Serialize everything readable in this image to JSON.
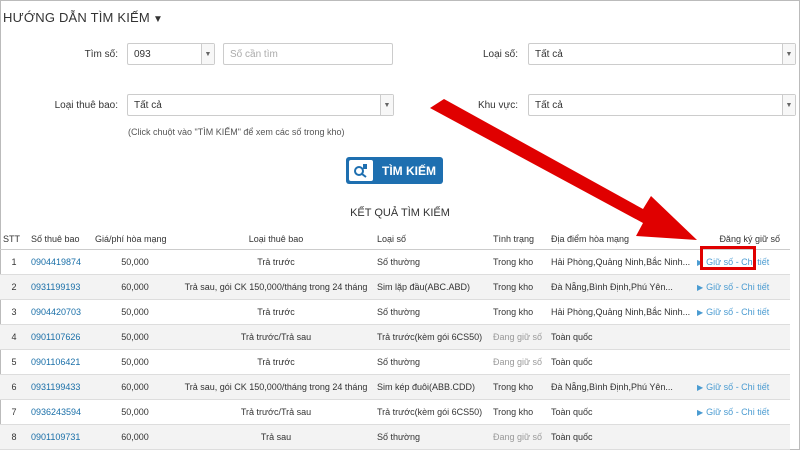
{
  "guide_title": "HƯỚNG DẪN TÌM KIẾM",
  "form": {
    "tim_so_label": "Tìm số:",
    "prefix_value": "093",
    "number_placeholder": "Số cần tìm",
    "loai_so_label": "Loại số:",
    "loai_so_value": "Tất cả",
    "loai_thue_bao_label": "Loại thuê bao:",
    "loai_thue_bao_value": "Tất cả",
    "khu_vuc_label": "Khu vực:",
    "khu_vuc_value": "Tất cả",
    "hint": "(Click chuột vào \"TÌM KIẾM\" để xem các số trong kho)",
    "search_button": "TÌM KIẾM"
  },
  "results": {
    "title": "KẾT QUẢ TÌM KIẾM",
    "headers": [
      "STT",
      "Số thuê bao",
      "Giá/phí hòa mạng",
      "Loại thuê bao",
      "Loại số",
      "Tình trạng",
      "Địa điểm hòa mạng",
      "Đăng ký giữ số"
    ],
    "rows": [
      [
        "1",
        "0904419874",
        "50,000",
        "Trả trước",
        "Số thường",
        "Trong kho",
        "Hải Phòng,Quảng Ninh,Bắc Ninh...",
        "Giữ số - Chi tiết"
      ],
      [
        "2",
        "0931199193",
        "60,000",
        "Trả sau, gói CK 150,000/tháng trong 24 tháng",
        "Sim lặp đầu(ABC.ABD)",
        "Trong kho",
        "Đà Nẵng,Bình Định,Phú Yên...",
        "Giữ số - Chi tiết"
      ],
      [
        "3",
        "0904420703",
        "50,000",
        "Trả trước",
        "Số thường",
        "Trong kho",
        "Hải Phòng,Quảng Ninh,Bắc Ninh...",
        "Giữ số - Chi tiết"
      ],
      [
        "4",
        "0901107626",
        "50,000",
        "Trả trước/Trả sau",
        "Trả trước(kèm gói 6CS50)",
        "Đang giữ số",
        "Toàn quốc",
        ""
      ],
      [
        "5",
        "0901106421",
        "50,000",
        "Trả trước",
        "Số thường",
        "Đang giữ số",
        "Toàn quốc",
        ""
      ],
      [
        "6",
        "0931199433",
        "60,000",
        "Trả sau, gói CK 150,000/tháng trong 24 tháng",
        "Sim kép đuôi(ABB.CDD)",
        "Trong kho",
        "Đà Nẵng,Bình Định,Phú Yên...",
        "Giữ số - Chi tiết"
      ],
      [
        "7",
        "0936243594",
        "50,000",
        "Trả trước/Trả sau",
        "Trả trước(kèm gói 6CS50)",
        "Trong kho",
        "Toàn quốc",
        "Giữ số - Chi tiết"
      ],
      [
        "8",
        "0901109731",
        "60,000",
        "Trả sau",
        "Số thường",
        "Đang giữ số",
        "Toàn quốc",
        ""
      ]
    ]
  },
  "colors": {
    "accent": "#1e6fb0",
    "link": "#1a6fa8",
    "annotation": "#e00000"
  },
  "icons": [
    "caret-down-icon",
    "search-icon",
    "play-icon",
    "arrow-annotation"
  ]
}
